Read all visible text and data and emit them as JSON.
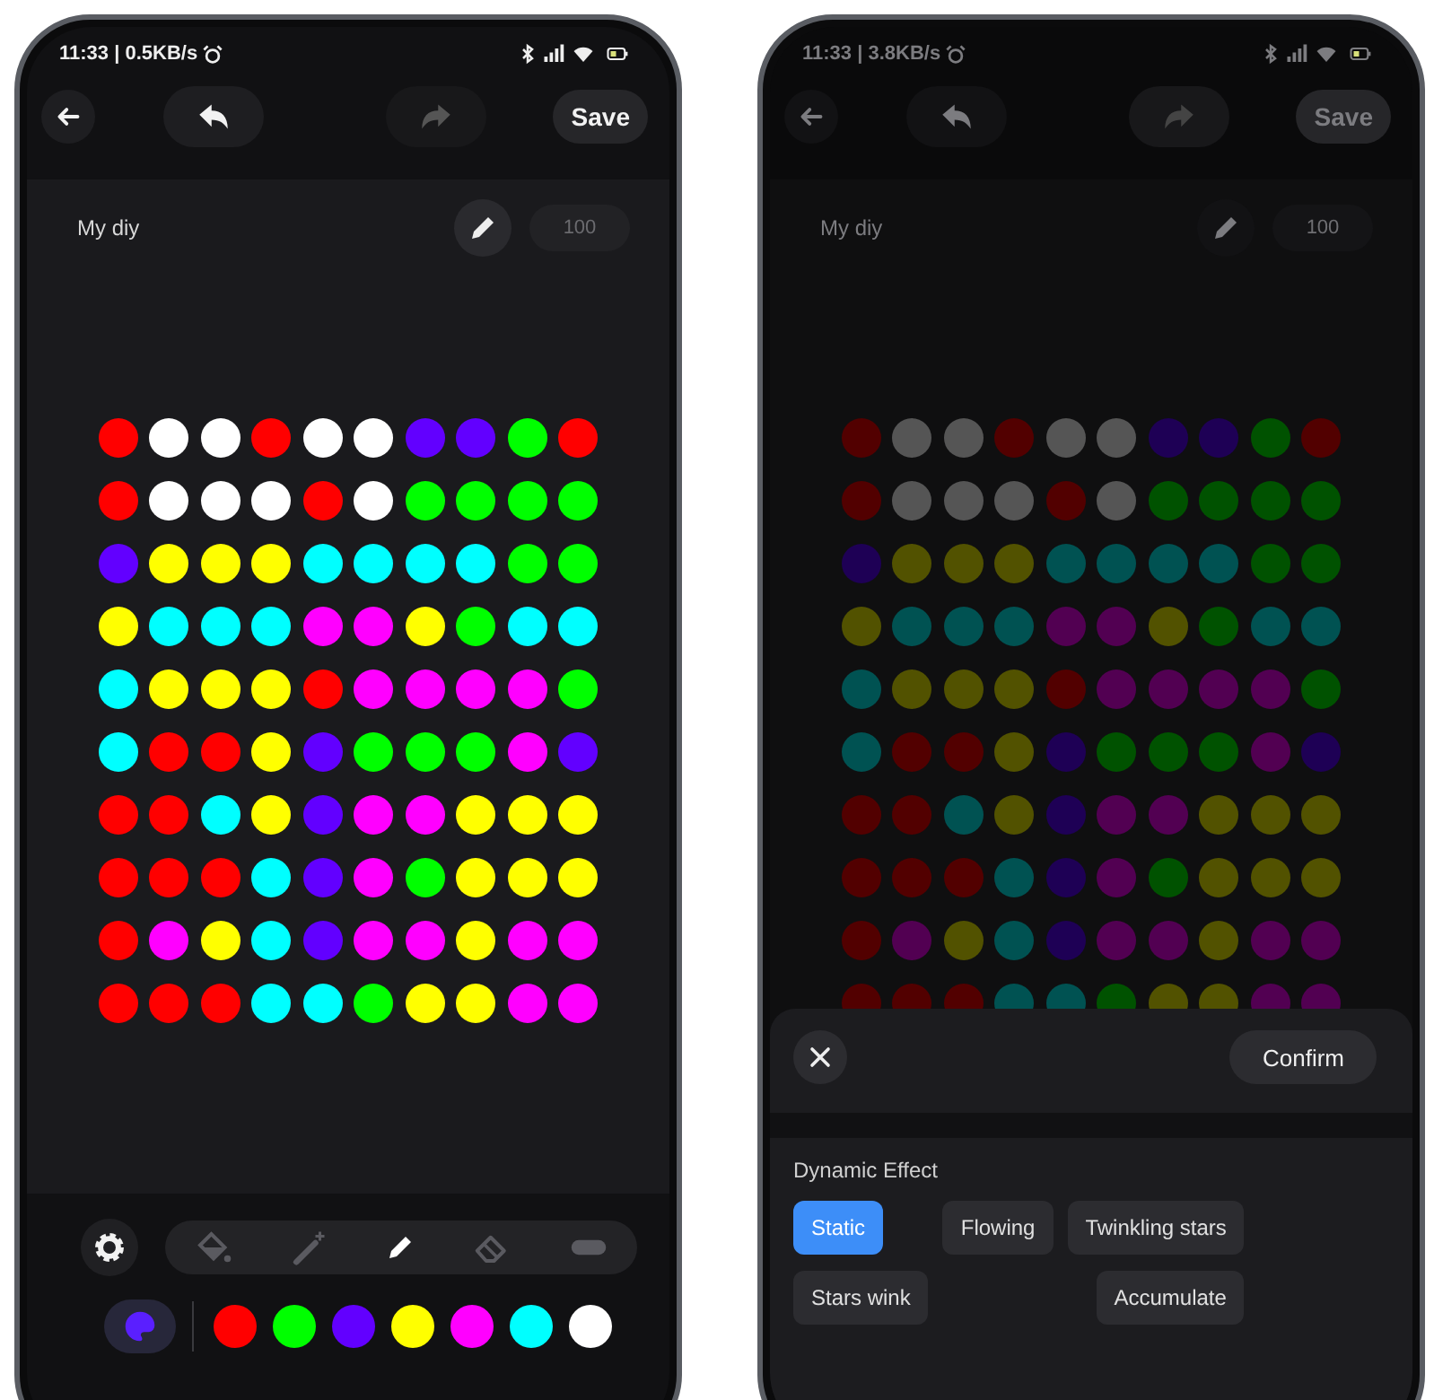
{
  "phones": [
    {
      "dimmed": false,
      "status_bar": {
        "time": "11:33 | 0.5KB/s"
      },
      "toolbar": [
        {
          "kind": "back",
          "disabled": false
        },
        {
          "kind": "undo",
          "disabled": false
        },
        {
          "kind": "redo",
          "disabled": true
        },
        {
          "kind": "save",
          "label": "Save",
          "disabled": false
        }
      ],
      "header": {
        "title": "My diy",
        "count": "100"
      },
      "grid": [
        [
          {
            "color": "#ff0000"
          },
          {
            "color": "#ffffff"
          },
          {
            "color": "#ffffff"
          },
          {
            "color": "#ff0000"
          },
          {
            "color": "#ffffff"
          },
          {
            "color": "#ffffff"
          },
          {
            "color": "#6200ff"
          },
          {
            "color": "#6200ff"
          },
          {
            "color": "#00ff00"
          },
          {
            "color": "#ff0000"
          }
        ],
        [
          {
            "color": "#ff0000"
          },
          {
            "color": "#ffffff"
          },
          {
            "color": "#ffffff"
          },
          {
            "color": "#ffffff"
          },
          {
            "color": "#ff0000"
          },
          {
            "color": "#ffffff"
          },
          {
            "color": "#00ff00"
          },
          {
            "color": "#00ff00"
          },
          {
            "color": "#00ff00"
          },
          {
            "color": "#00ff00"
          }
        ],
        [
          {
            "color": "#6200ff"
          },
          {
            "color": "#ffff00"
          },
          {
            "color": "#ffff00"
          },
          {
            "color": "#ffff00"
          },
          {
            "color": "#00ffff"
          },
          {
            "color": "#00ffff"
          },
          {
            "color": "#00ffff"
          },
          {
            "color": "#00ffff"
          },
          {
            "color": "#00ff00"
          },
          {
            "color": "#00ff00"
          }
        ],
        [
          {
            "color": "#ffff00"
          },
          {
            "color": "#00ffff"
          },
          {
            "color": "#00ffff"
          },
          {
            "color": "#00ffff"
          },
          {
            "color": "#ff00ff"
          },
          {
            "color": "#ff00ff"
          },
          {
            "color": "#ffff00"
          },
          {
            "color": "#00ff00"
          },
          {
            "color": "#00ffff"
          },
          {
            "color": "#00ffff"
          }
        ],
        [
          {
            "color": "#00ffff"
          },
          {
            "color": "#ffff00"
          },
          {
            "color": "#ffff00"
          },
          {
            "color": "#ffff00"
          },
          {
            "color": "#ff0000"
          },
          {
            "color": "#ff00ff"
          },
          {
            "color": "#ff00ff"
          },
          {
            "color": "#ff00ff"
          },
          {
            "color": "#ff00ff"
          },
          {
            "color": "#00ff00"
          }
        ],
        [
          {
            "color": "#00ffff"
          },
          {
            "color": "#ff0000"
          },
          {
            "color": "#ff0000"
          },
          {
            "color": "#ffff00"
          },
          {
            "color": "#6200ff"
          },
          {
            "color": "#00ff00"
          },
          {
            "color": "#00ff00"
          },
          {
            "color": "#00ff00"
          },
          {
            "color": "#ff00ff"
          },
          {
            "color": "#6200ff"
          }
        ],
        [
          {
            "color": "#ff0000"
          },
          {
            "color": "#ff0000"
          },
          {
            "color": "#00ffff"
          },
          {
            "color": "#ffff00"
          },
          {
            "color": "#6200ff"
          },
          {
            "color": "#ff00ff"
          },
          {
            "color": "#ff00ff"
          },
          {
            "color": "#ffff00"
          },
          {
            "color": "#ffff00"
          },
          {
            "color": "#ffff00"
          }
        ],
        [
          {
            "color": "#ff0000"
          },
          {
            "color": "#ff0000"
          },
          {
            "color": "#ff0000"
          },
          {
            "color": "#00ffff"
          },
          {
            "color": "#6200ff"
          },
          {
            "color": "#ff00ff"
          },
          {
            "color": "#00ff00"
          },
          {
            "color": "#ffff00"
          },
          {
            "color": "#ffff00"
          },
          {
            "color": "#ffff00"
          }
        ],
        [
          {
            "color": "#ff0000"
          },
          {
            "color": "#ff00ff"
          },
          {
            "color": "#ffff00"
          },
          {
            "color": "#00ffff"
          },
          {
            "color": "#6200ff"
          },
          {
            "color": "#ff00ff"
          },
          {
            "color": "#ff00ff"
          },
          {
            "color": "#ffff00"
          },
          {
            "color": "#ff00ff"
          },
          {
            "color": "#ff00ff"
          }
        ],
        [
          {
            "color": "#ff0000"
          },
          {
            "color": "#ff0000"
          },
          {
            "color": "#ff0000"
          },
          {
            "color": "#00ffff"
          },
          {
            "color": "#00ffff"
          },
          {
            "color": "#00ff00"
          },
          {
            "color": "#ffff00"
          },
          {
            "color": "#ffff00"
          },
          {
            "color": "#ff00ff"
          },
          {
            "color": "#ff00ff"
          }
        ]
      ],
      "tools": [
        {
          "kind": "bucket",
          "selected": false
        },
        {
          "kind": "wand",
          "selected": false
        },
        {
          "kind": "pencil",
          "selected": true
        },
        {
          "kind": "eraser",
          "selected": false
        },
        {
          "kind": "toggle",
          "selected": false
        }
      ],
      "palette": [
        {
          "color": "#ff0000"
        },
        {
          "color": "#00ff00"
        },
        {
          "color": "#6200ff"
        },
        {
          "color": "#ffff00"
        },
        {
          "color": "#ff00ff"
        },
        {
          "color": "#00ffff"
        },
        {
          "color": "#ffffff"
        }
      ]
    },
    {
      "dimmed": true,
      "status_bar": {
        "time": "11:33 | 3.8KB/s"
      },
      "toolbar": [
        {
          "kind": "back",
          "disabled": false
        },
        {
          "kind": "undo",
          "disabled": false
        },
        {
          "kind": "redo",
          "disabled": true
        },
        {
          "kind": "save",
          "label": "Save",
          "disabled": false
        }
      ],
      "header": {
        "title": "My diy",
        "count": "100"
      },
      "grid": [
        [
          {
            "color": "#520000"
          },
          {
            "color": "#555555"
          },
          {
            "color": "#555555"
          },
          {
            "color": "#520000"
          },
          {
            "color": "#555555"
          },
          {
            "color": "#555555"
          },
          {
            "color": "#1e0055"
          },
          {
            "color": "#1e0055"
          },
          {
            "color": "#005200"
          },
          {
            "color": "#520000"
          }
        ],
        [
          {
            "color": "#520000"
          },
          {
            "color": "#555555"
          },
          {
            "color": "#555555"
          },
          {
            "color": "#555555"
          },
          {
            "color": "#520000"
          },
          {
            "color": "#555555"
          },
          {
            "color": "#005200"
          },
          {
            "color": "#005200"
          },
          {
            "color": "#005200"
          },
          {
            "color": "#005200"
          }
        ],
        [
          {
            "color": "#1e0055"
          },
          {
            "color": "#525200"
          },
          {
            "color": "#525200"
          },
          {
            "color": "#525200"
          },
          {
            "color": "#005252"
          },
          {
            "color": "#005252"
          },
          {
            "color": "#005252"
          },
          {
            "color": "#005252"
          },
          {
            "color": "#005200"
          },
          {
            "color": "#005200"
          }
        ],
        [
          {
            "color": "#525200"
          },
          {
            "color": "#005252"
          },
          {
            "color": "#005252"
          },
          {
            "color": "#005252"
          },
          {
            "color": "#520052"
          },
          {
            "color": "#520052"
          },
          {
            "color": "#525200"
          },
          {
            "color": "#005200"
          },
          {
            "color": "#005252"
          },
          {
            "color": "#005252"
          }
        ],
        [
          {
            "color": "#005252"
          },
          {
            "color": "#525200"
          },
          {
            "color": "#525200"
          },
          {
            "color": "#525200"
          },
          {
            "color": "#520000"
          },
          {
            "color": "#520052"
          },
          {
            "color": "#520052"
          },
          {
            "color": "#520052"
          },
          {
            "color": "#520052"
          },
          {
            "color": "#005200"
          }
        ],
        [
          {
            "color": "#005252"
          },
          {
            "color": "#520000"
          },
          {
            "color": "#520000"
          },
          {
            "color": "#525200"
          },
          {
            "color": "#1e0055"
          },
          {
            "color": "#005200"
          },
          {
            "color": "#005200"
          },
          {
            "color": "#005200"
          },
          {
            "color": "#520052"
          },
          {
            "color": "#1e0055"
          }
        ],
        [
          {
            "color": "#520000"
          },
          {
            "color": "#520000"
          },
          {
            "color": "#005252"
          },
          {
            "color": "#525200"
          },
          {
            "color": "#1e0055"
          },
          {
            "color": "#520052"
          },
          {
            "color": "#520052"
          },
          {
            "color": "#525200"
          },
          {
            "color": "#525200"
          },
          {
            "color": "#525200"
          }
        ],
        [
          {
            "color": "#520000"
          },
          {
            "color": "#520000"
          },
          {
            "color": "#520000"
          },
          {
            "color": "#005252"
          },
          {
            "color": "#1e0055"
          },
          {
            "color": "#520052"
          },
          {
            "color": "#005200"
          },
          {
            "color": "#525200"
          },
          {
            "color": "#525200"
          },
          {
            "color": "#525200"
          }
        ],
        [
          {
            "color": "#520000"
          },
          {
            "color": "#520052"
          },
          {
            "color": "#525200"
          },
          {
            "color": "#005252"
          },
          {
            "color": "#1e0055"
          },
          {
            "color": "#520052"
          },
          {
            "color": "#520052"
          },
          {
            "color": "#525200"
          },
          {
            "color": "#520052"
          },
          {
            "color": "#520052"
          }
        ],
        [
          {
            "color": "#520000"
          },
          {
            "color": "#520000"
          },
          {
            "color": "#520000"
          },
          {
            "color": "#005252"
          },
          {
            "color": "#005252"
          },
          {
            "color": "#005200"
          },
          {
            "color": "#525200"
          },
          {
            "color": "#525200"
          },
          {
            "color": "#520052"
          },
          {
            "color": "#520052"
          }
        ]
      ],
      "sheet": {
        "confirm": "Confirm",
        "section": "Dynamic Effect",
        "effects": [
          {
            "label": "Static",
            "selected": true
          },
          {
            "label": "Flowing",
            "selected": false
          },
          {
            "label": "Twinkling stars",
            "selected": false
          },
          {
            "label": "Stars wink",
            "selected": false
          },
          {
            "label": "Accumulate",
            "selected": false
          }
        ]
      }
    }
  ]
}
